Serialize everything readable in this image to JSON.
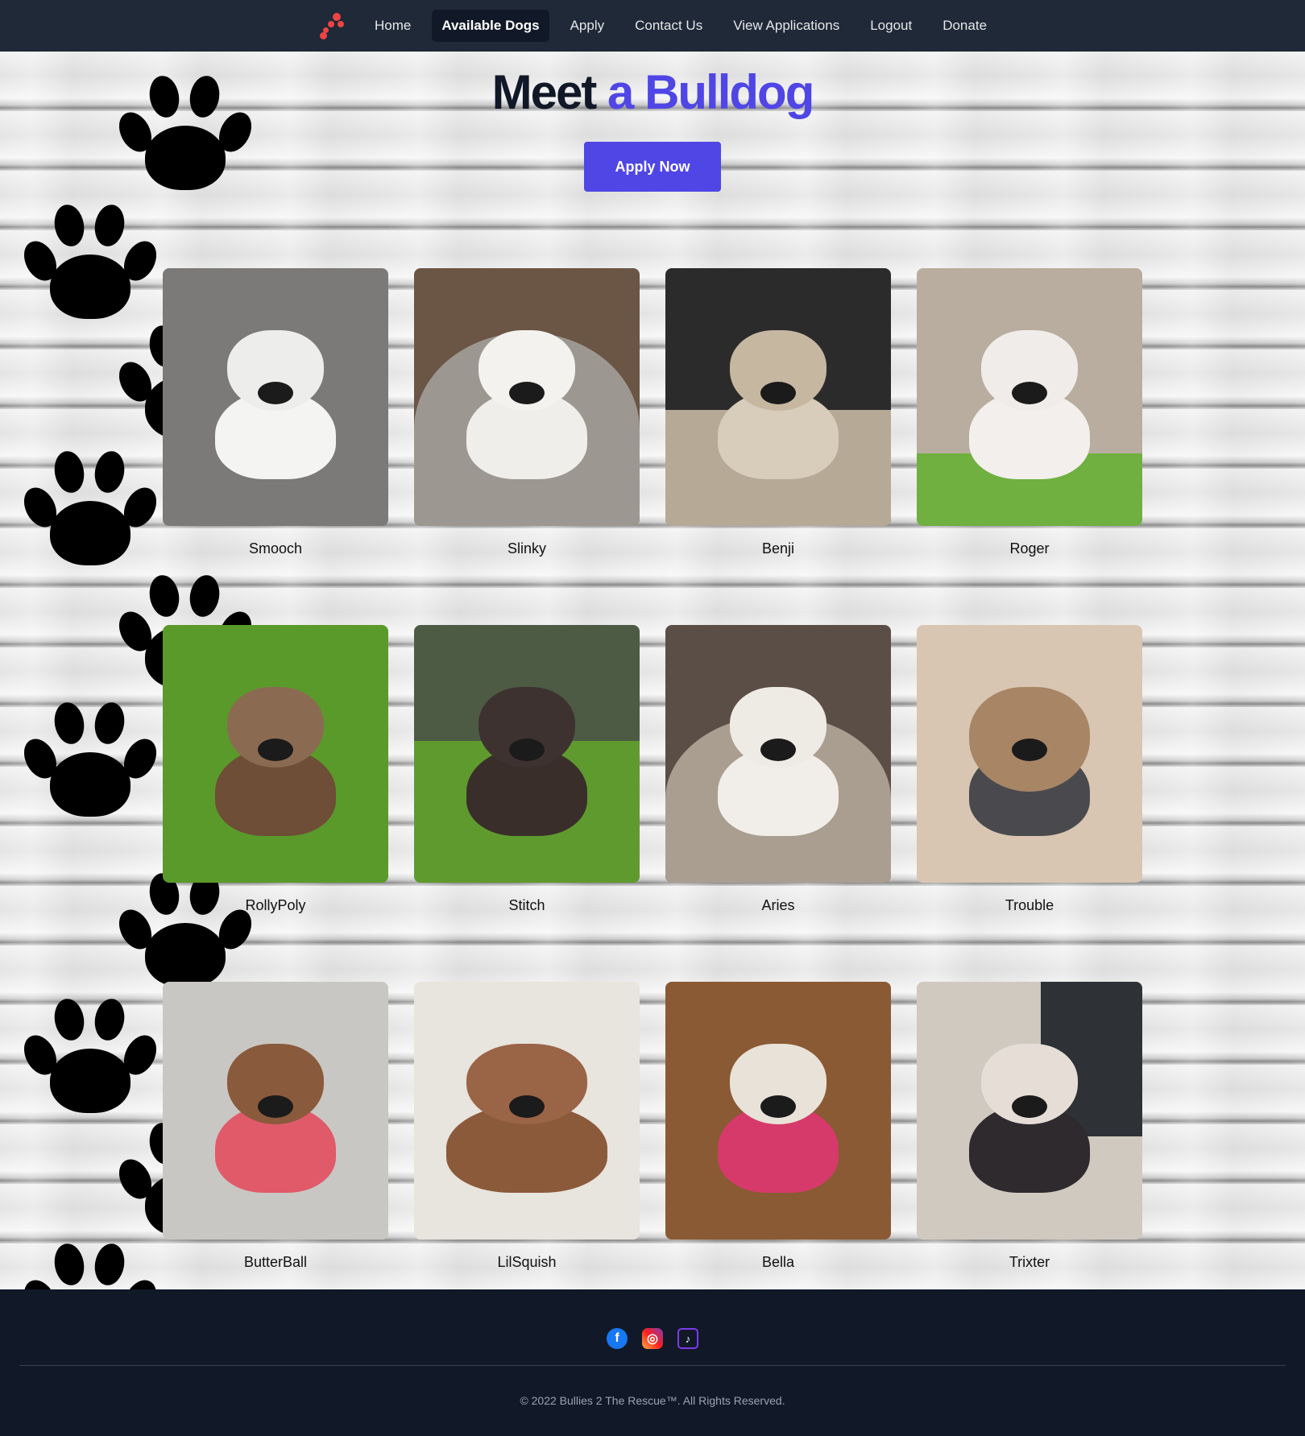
{
  "nav": {
    "logo_icon": "paw-logo-icon",
    "links": [
      "Home",
      "Available Dogs",
      "Apply",
      "Contact Us",
      "View Applications",
      "Logout",
      "Donate"
    ],
    "active": "Available Dogs"
  },
  "hero": {
    "title_main": "Meet",
    "title_accent": "a Bulldog",
    "apply_button": "Apply Now"
  },
  "dogs": [
    {
      "name": "Smooch"
    },
    {
      "name": "Slinky"
    },
    {
      "name": "Benji"
    },
    {
      "name": "Roger"
    },
    {
      "name": "RollyPoly"
    },
    {
      "name": "Stitch"
    },
    {
      "name": "Aries"
    },
    {
      "name": "Trouble"
    },
    {
      "name": "ButterBall"
    },
    {
      "name": "LilSquish"
    },
    {
      "name": "Bella"
    },
    {
      "name": "Trixter"
    }
  ],
  "footer": {
    "socials": [
      "facebook-icon",
      "instagram-icon",
      "tiktok-icon"
    ],
    "copyright": "© 2022 Bullies 2 The Rescue™. All Rights Reserved."
  },
  "colors": {
    "nav_bg": "#1f2937",
    "footer_bg": "#111827",
    "accent": "#4f46e5"
  }
}
